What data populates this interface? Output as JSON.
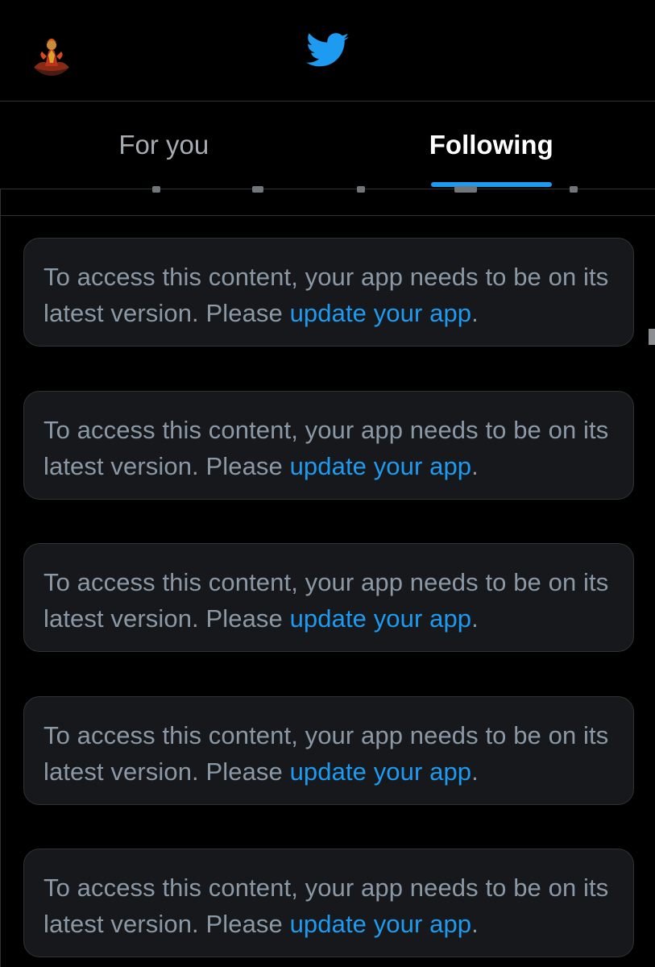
{
  "tabs": [
    {
      "label": "For you",
      "active": false
    },
    {
      "label": "Following",
      "active": true
    }
  ],
  "notices": [
    {
      "text": "To access this content, your app needs to be on its latest version. Please ",
      "link": "update your app",
      "end": "."
    },
    {
      "text": "To access this content, your app needs to be on its latest version. Please ",
      "link": "update your app",
      "end": "."
    },
    {
      "text": "To access this content, your app needs to be on its latest version. Please ",
      "link": "update your app",
      "end": "."
    },
    {
      "text": "To access this content, your app needs to be on its latest version. Please ",
      "link": "update your app",
      "end": "."
    },
    {
      "text": "To access this content, your app needs to be on its latest version. Please ",
      "link": "update your app",
      "end": "."
    }
  ],
  "icons": {
    "logo": "twitter-bird-icon",
    "avatar": "profile-avatar"
  },
  "colors": {
    "background": "#000000",
    "accent": "#1d9bf0",
    "card": "#16181c",
    "border": "#2f3336",
    "muted_text": "#8b98a5"
  }
}
